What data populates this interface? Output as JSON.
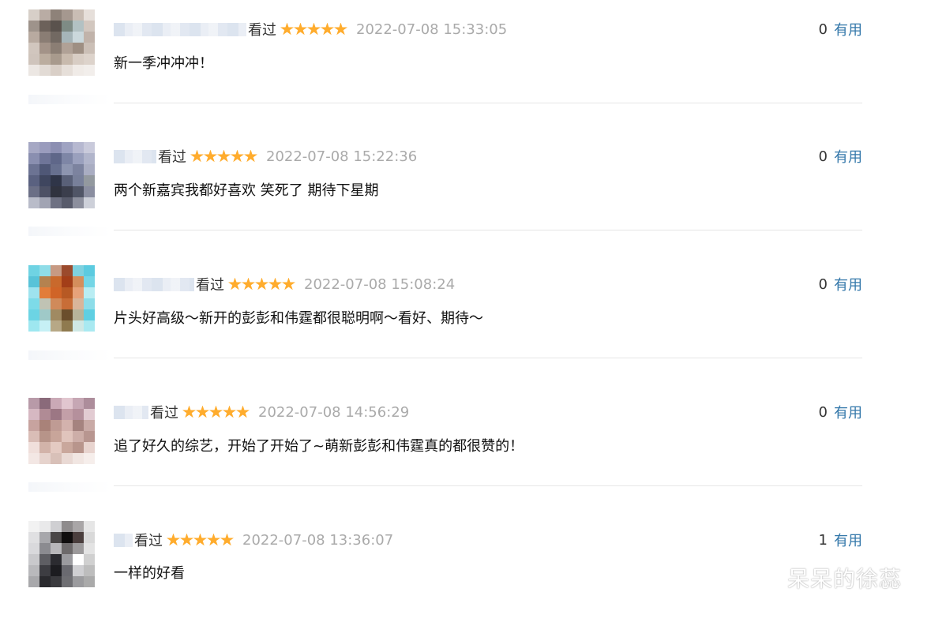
{
  "comments": [
    {
      "watched": "看过",
      "rating_stars": 5,
      "time": "2022-07-08 15:33:05",
      "text": "新一季冲冲冲！",
      "useful_count": "0",
      "useful_label": "有用",
      "avatar_colors": [
        "#d7cfc8",
        "#b9aca4",
        "#8e8279",
        "#a5988f",
        "#c9bdb4",
        "#e6dfda",
        "#9e938b",
        "#6c615a",
        "#5a524d",
        "#7e8b85",
        "#b2c1c3",
        "#d2c7bf",
        "#b8aaa0",
        "#8a7d74",
        "#726962",
        "#a6b5b9",
        "#cbd8dc",
        "#c1b3aa",
        "#d1c6be",
        "#a39388",
        "#8b7e74",
        "#b0a196",
        "#9e8f83",
        "#cbbfb6",
        "#cfc4bc",
        "#bbad9f",
        "#a89a8d",
        "#c8baad",
        "#d8cdc4",
        "#ddd3cb",
        "#ece7e3",
        "#e2dbd5",
        "#d9cfc7",
        "#e6dfd9",
        "#f0ebe7",
        "#f2eeeb"
      ]
    },
    {
      "watched": "看过",
      "rating_stars": 5,
      "time": "2022-07-08 15:22:36",
      "text": "两个新嘉宾我都好喜欢 笑死了 期待下星期",
      "useful_count": "0",
      "useful_label": "有用",
      "avatar_colors": [
        "#a6a8c4",
        "#9a9cbd",
        "#8c8fb2",
        "#9fa3c2",
        "#b6b8d0",
        "#c9cadb",
        "#8a8fb0",
        "#6f7598",
        "#5f6789",
        "#7e86a6",
        "#9aa0bd",
        "#b1b5cb",
        "#6c7393",
        "#4f5776",
        "#67708f",
        "#8d95b0",
        "#7c839f",
        "#a9adc2",
        "#5a6180",
        "#3f465f",
        "#2f3548",
        "#596078",
        "#78809a",
        "#93999f",
        "#6b6f86",
        "#4d5165",
        "#30333f",
        "#3b3e4c",
        "#505566",
        "#8a8ea0",
        "#b9bcc9",
        "#a1a4b3",
        "#6e7183",
        "#585b6b",
        "#8c8f9d",
        "#cdd0d9"
      ]
    },
    {
      "watched": "看过",
      "rating_stars": 5,
      "time": "2022-07-08 15:08:24",
      "text": "片头好高级～新开的彭彭和伟霆都很聪明啊～看好、期待～",
      "useful_count": "0",
      "useful_label": "有用",
      "avatar_colors": [
        "#6fd3e3",
        "#8fdde8",
        "#c79a83",
        "#9b4a2c",
        "#7fd1df",
        "#5ccbe0",
        "#58c3d8",
        "#b4824f",
        "#c9692c",
        "#a33e18",
        "#d48e5c",
        "#74d6e6",
        "#9ee3ee",
        "#e27d3a",
        "#d06427",
        "#b75924",
        "#e7a27a",
        "#b9edf3",
        "#7ddbe8",
        "#c0c3b4",
        "#d08a5a",
        "#c86d37",
        "#d9b59a",
        "#8ddde9",
        "#6cd4e4",
        "#9fc9c8",
        "#a08a62",
        "#6b4e2c",
        "#b7b49a",
        "#5fcfe2",
        "#9ee7f0",
        "#c6f0f5",
        "#b7a886",
        "#8f7a4f",
        "#cfe8e5",
        "#a9e9f1"
      ]
    },
    {
      "watched": "看过",
      "rating_stars": 5,
      "time": "2022-07-08 14:56:29",
      "text": "追了好久的综艺，开始了开始了~萌新彭彭和伟霆真的都很赞的！",
      "useful_count": "0",
      "useful_label": "有用",
      "avatar_colors": [
        "#b89aa8",
        "#8a6a7a",
        "#caa9b6",
        "#e1c6cf",
        "#c6a7b4",
        "#ad8d9b",
        "#d6b8c2",
        "#b08b95",
        "#9c7784",
        "#c39fa8",
        "#b5909c",
        "#e2cbd2",
        "#c7a39f",
        "#a98279",
        "#bf9b94",
        "#d3b2ad",
        "#a5837f",
        "#c9aaa6",
        "#d9bdb6",
        "#b79489",
        "#c8a59a",
        "#e0c4bc",
        "#cdaea8",
        "#b89690",
        "#f0dfdb",
        "#d2b3a9",
        "#e4cac2",
        "#c9a79c",
        "#b8958c",
        "#e8d4cf",
        "#f3e7e4",
        "#e6d3cd",
        "#d8c0b8",
        "#e9d9d4",
        "#f1e6e2",
        "#f6eeeb"
      ]
    },
    {
      "watched": "看过",
      "rating_stars": 5,
      "time": "2022-07-08 13:36:07",
      "text": "一样的好看",
      "useful_count": "1",
      "useful_label": "有用",
      "avatar_colors": [
        "#f2f2f2",
        "#e9e9ea",
        "#cfcfd2",
        "#8e8b8c",
        "#a9a6a7",
        "#e6e6e6",
        "#e0e0e2",
        "#a7a7ab",
        "#4a4747",
        "#0f0d0d",
        "#4a3e3d",
        "#d9d9d9",
        "#d9d9dc",
        "#8b8b90",
        "#b8b7ba",
        "#6d6a6b",
        "#9c9a9b",
        "#e3e3e3",
        "#c9c9cc",
        "#5e5e63",
        "#2b2b30",
        "#9b9b9f",
        "#ffffff",
        "#d0d0d0",
        "#b9b9bc",
        "#3d3d42",
        "#1c1c20",
        "#6a6a70",
        "#cfcfd2",
        "#bdbdbd",
        "#a8a8ab",
        "#2a2a2e",
        "#3a3a3e",
        "#6f6f73",
        "#9b9b9e",
        "#aaaaaa"
      ]
    }
  ],
  "watermark": "呆呆的徐蕊"
}
